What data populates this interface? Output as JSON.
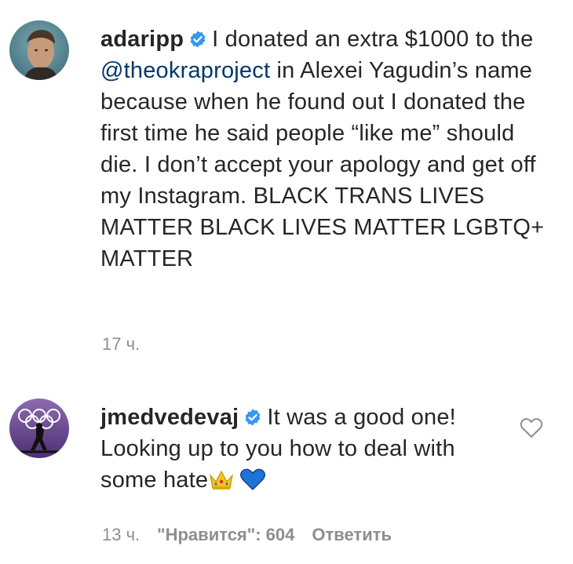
{
  "comments": [
    {
      "username": "adaripp",
      "text_before_mention": "I donated an extra $1000 to the ",
      "mention": "@theokraproject",
      "text_after_mention": " in Alexei Yagudin’s name because when he found out I donated the first time he said people “like me” should die. I don’t accept your apology and get off my Instagram. BLACK TRANS LIVES MATTER BLACK LIVES MATTER LGBTQ+ MATTER",
      "time": "17 ч."
    },
    {
      "username": "jmedvedevaj",
      "text": "It was a good one! Looking up to you how to deal with some hate",
      "time": "13 ч.",
      "likes_label": "\"Нравится\": 604",
      "reply_label": "Ответить"
    }
  ],
  "icons": {
    "verified": "verified-badge-icon",
    "like": "heart-outline-icon",
    "emoji_1": "crown-emoji",
    "emoji_2": "blue-heart-emoji"
  },
  "colors": {
    "text": "#262626",
    "mention": "#00376b",
    "meta": "#8e8e8e",
    "verified": "#3897f0"
  }
}
